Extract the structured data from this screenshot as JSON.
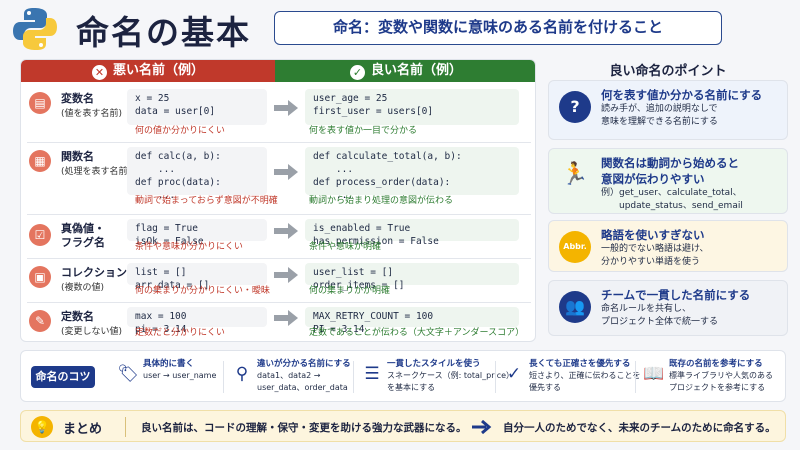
{
  "header": {
    "title": "命名の基本",
    "subtitle": "命名：変数や関数に意味のある名前を付けること"
  },
  "table": {
    "bad_header": "悪い名前（例）",
    "good_header": "良い名前（例）",
    "rows": [
      {
        "label": "変数名",
        "sub": "(値を表す名前)",
        "bad_code": "x = 25\ndata = user[0]",
        "bad_note": "何の値か分かりにくい",
        "good_code": "user_age = 25\nfirst_user = users[0]",
        "good_note": "何を表す値か一目で分かる"
      },
      {
        "label": "関数名",
        "sub": "(処理を表す名前)",
        "bad_code": "def calc(a, b):\n    ...\ndef proc(data):\n    ...",
        "bad_note": "動詞で始まっておらず意図が不明確",
        "good_code": "def calculate_total(a, b):\n    ...\ndef process_order(data):\n    ...",
        "good_note": "動詞から始まり処理の意図が伝わる"
      },
      {
        "label": "真偽値・\nフラグ名",
        "sub": "",
        "bad_code": "flag = True\nisOk = False",
        "bad_note": "条件や意味が分かりにくい",
        "good_code": "is_enabled = True\nhas_permission = False",
        "good_note": "条件や意味が明確"
      },
      {
        "label": "コレクション名",
        "sub": "(複数の値)",
        "bad_code": "list = []\narr_data = []",
        "bad_note": "何の集まりか分かりにくい・曖昧",
        "good_code": "user_list = []\norder_items = []",
        "good_note": "何の集まりかが明確"
      },
      {
        "label": "定数名",
        "sub": "(変更しない値)",
        "bad_code": "max = 100\npi = 3.14",
        "bad_note": "定数だと分かりにくい",
        "good_code": "MAX_RETRY_COUNT = 100\nPI = 3.14",
        "good_note": "定数であることが伝わる（大文字＋アンダースコア）"
      }
    ]
  },
  "points": {
    "title": "良い命名のポイント",
    "cards": [
      {
        "title": "何を表す値か分かる名前にする",
        "body": "読み手が、追加の説明なしで\n意味を理解できる名前にする",
        "icon": "question-icon",
        "color": "#1e3a8a"
      },
      {
        "title": "関数名は動詞から始めると\n意図が伝わりやすい",
        "body": "例）get_user、calculate_total、\n　　update_status、send_email",
        "icon": "running-icon",
        "color": "#2e7d32"
      },
      {
        "title": "略語を使いすぎない",
        "body": "一般的でない略語は避け、\n分かりやすい単語を使う",
        "icon": "abbr-icon",
        "icon_text": "Abbr.",
        "color": "#f4b400"
      },
      {
        "title": "チームで一貫した名前にする",
        "body": "命名ルールを共有し、\nプロジェクト全体で統一する",
        "icon": "team-icon",
        "color": "#1e3a8a"
      }
    ]
  },
  "tips": {
    "badge": "命名のコツ",
    "items": [
      {
        "title": "具体的に書く",
        "body": "user → user_name",
        "icon": "tag-icon"
      },
      {
        "title": "違いが分かる名前にする",
        "body": "data1、data2 →\nuser_data、order_data",
        "icon": "search-icon"
      },
      {
        "title": "一貫したスタイルを使う",
        "body": "スネークケース（例: total_price）\nを基本にする",
        "icon": "list-icon"
      },
      {
        "title": "長くても正確さを優先する",
        "body": "短さより、正確に伝わることを\n優先する",
        "icon": "check-icon"
      },
      {
        "title": "既存の名前を参考にする",
        "body": "標準ライブラリや人気のある\nプロジェクトを参考にする",
        "icon": "book-icon"
      }
    ]
  },
  "summary": {
    "title": "まとめ",
    "text1": "良い名前は、コードの理解・保守・変更を助ける強力な武器になる。",
    "text2": "自分一人のためでなく、未来のチームのために命名する。"
  }
}
